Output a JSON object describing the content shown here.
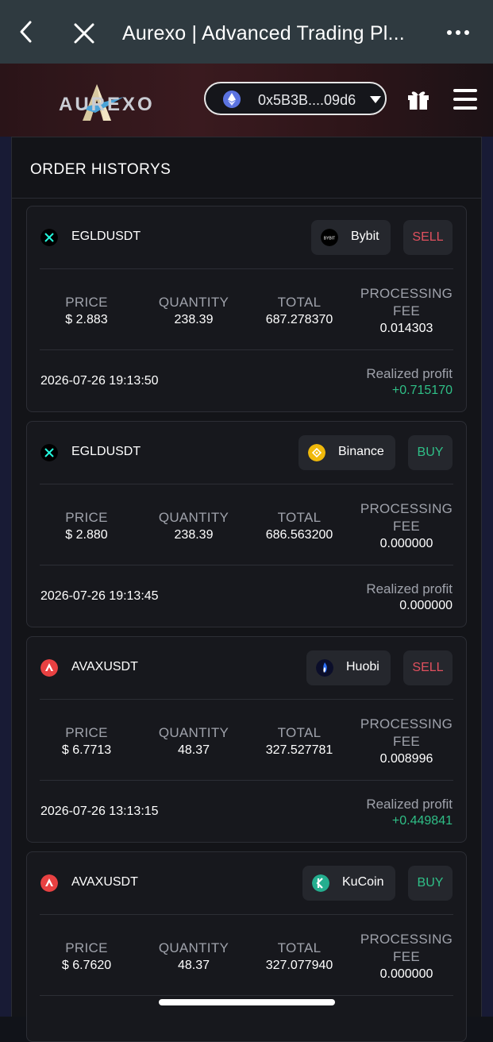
{
  "browser": {
    "title": "Aurexo | Advanced Trading Pl..."
  },
  "header": {
    "brand": "AUREXO",
    "wallet_address": "0x5B3B....09d6"
  },
  "panel": {
    "title": "ORDER HISTORYS"
  },
  "labels": {
    "price": "PRICE",
    "quantity": "QUANTITY",
    "total": "TOTAL",
    "fee_line1": "PROCESSING",
    "fee_line2": "FEE",
    "realized": "Realized profit"
  },
  "orders": [
    {
      "pair": "EGLDUSDT",
      "exchange": "Bybit",
      "side": "SELL",
      "price": "$ 2.883",
      "quantity": "238.39",
      "total": "687.278370",
      "fee": "0.014303",
      "time": "2026-07-26 19:13:50",
      "profit": "+0.715170"
    },
    {
      "pair": "EGLDUSDT",
      "exchange": "Binance",
      "side": "BUY",
      "price": "$ 2.880",
      "quantity": "238.39",
      "total": "686.563200",
      "fee": "0.000000",
      "time": "2026-07-26 19:13:45",
      "profit": "0.000000"
    },
    {
      "pair": "AVAXUSDT",
      "exchange": "Huobi",
      "side": "SELL",
      "price": "$ 6.7713",
      "quantity": "48.37",
      "total": "327.527781",
      "fee": "0.008996",
      "time": "2026-07-26 13:13:15",
      "profit": "+0.449841"
    },
    {
      "pair": "AVAXUSDT",
      "exchange": "KuCoin",
      "side": "BUY",
      "price": "$ 6.7620",
      "quantity": "48.37",
      "total": "327.077940",
      "fee": "0.000000"
    }
  ],
  "colors": {
    "sell": "#e0505e",
    "buy": "#2fbf87",
    "profit_positive": "#2fbf87"
  }
}
